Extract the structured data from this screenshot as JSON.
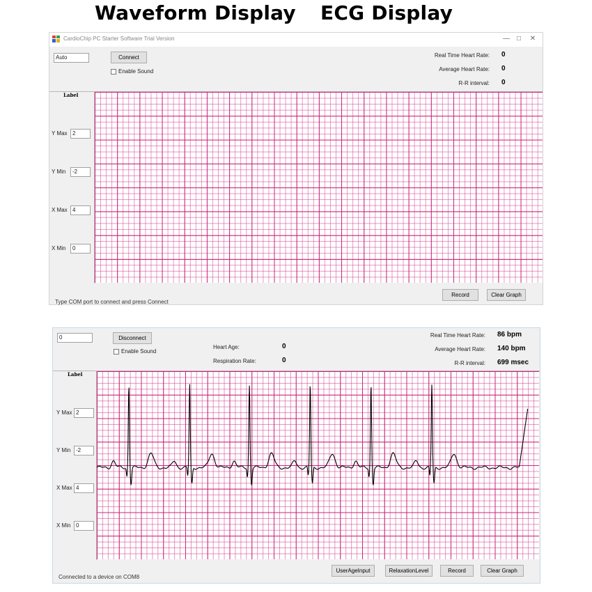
{
  "titles": {
    "waveform": "Waveform Display",
    "ecg": "ECG Display"
  },
  "window1": {
    "title": "CardioChip PC Starter Software Trial Version",
    "port_value": "Auto",
    "connect_label": "Connect",
    "enable_sound_label": "Enable Sound",
    "stats": {
      "rt_label": "Real Time Heart Rate:",
      "rt_value": "0",
      "avg_label": "Average Heart Rate:",
      "avg_value": "0",
      "rr_label": "R-R interval:",
      "rr_value": "0"
    },
    "axis_label": "Label",
    "limits": {
      "ymax_label": "Y Max",
      "ymax_value": "2",
      "ymin_label": "Y Min",
      "ymin_value": "-2",
      "xmax_label": "X Max",
      "xmax_value": "4",
      "xmin_label": "X Min",
      "xmin_value": "0"
    },
    "status": "Type COM port to connect and press Connect",
    "record_label": "Record",
    "clear_label": "Clear Graph"
  },
  "window2": {
    "port_value": "0",
    "disconnect_label": "Disconnect",
    "enable_sound_label": "Enable Sound",
    "heart_age_label": "Heart Age:",
    "heart_age_value": "0",
    "resp_label": "Respiration Rate:",
    "resp_value": "0",
    "stats": {
      "rt_label": "Real Time Heart Rate:",
      "rt_value": "86 bpm",
      "avg_label": "Average Heart Rate:",
      "avg_value": "140 bpm",
      "rr_label": "R-R interval:",
      "rr_value": "699 msec"
    },
    "axis_label": "Label",
    "limits": {
      "ymax_label": "Y Max",
      "ymax_value": "2",
      "ymin_label": "Y Min",
      "ymin_value": "-2",
      "xmax_label": "X Max",
      "xmax_value": "4",
      "xmin_label": "X Min",
      "xmin_value": "0"
    },
    "status": "Connected to a device on COM8",
    "user_age_label": "UserAgeInput",
    "relaxation_label": "RelaxationLevel",
    "record_label": "Record",
    "clear_label": "Clear Graph"
  },
  "colors": {
    "grid_major": "#c81e78",
    "trace": "#000000",
    "window_bg": "#f0f0f0"
  },
  "icons": [
    "app-icon",
    "minimize-icon",
    "maximize-icon",
    "close-icon"
  ],
  "chart_data": {
    "type": "line",
    "x_range": [
      0,
      4
    ],
    "y_range": [
      -2,
      2
    ],
    "beat_times": [
      0.29,
      0.84,
      1.38,
      1.93,
      2.48,
      3.03
    ],
    "series": [
      {
        "values": []
      }
    ]
  }
}
